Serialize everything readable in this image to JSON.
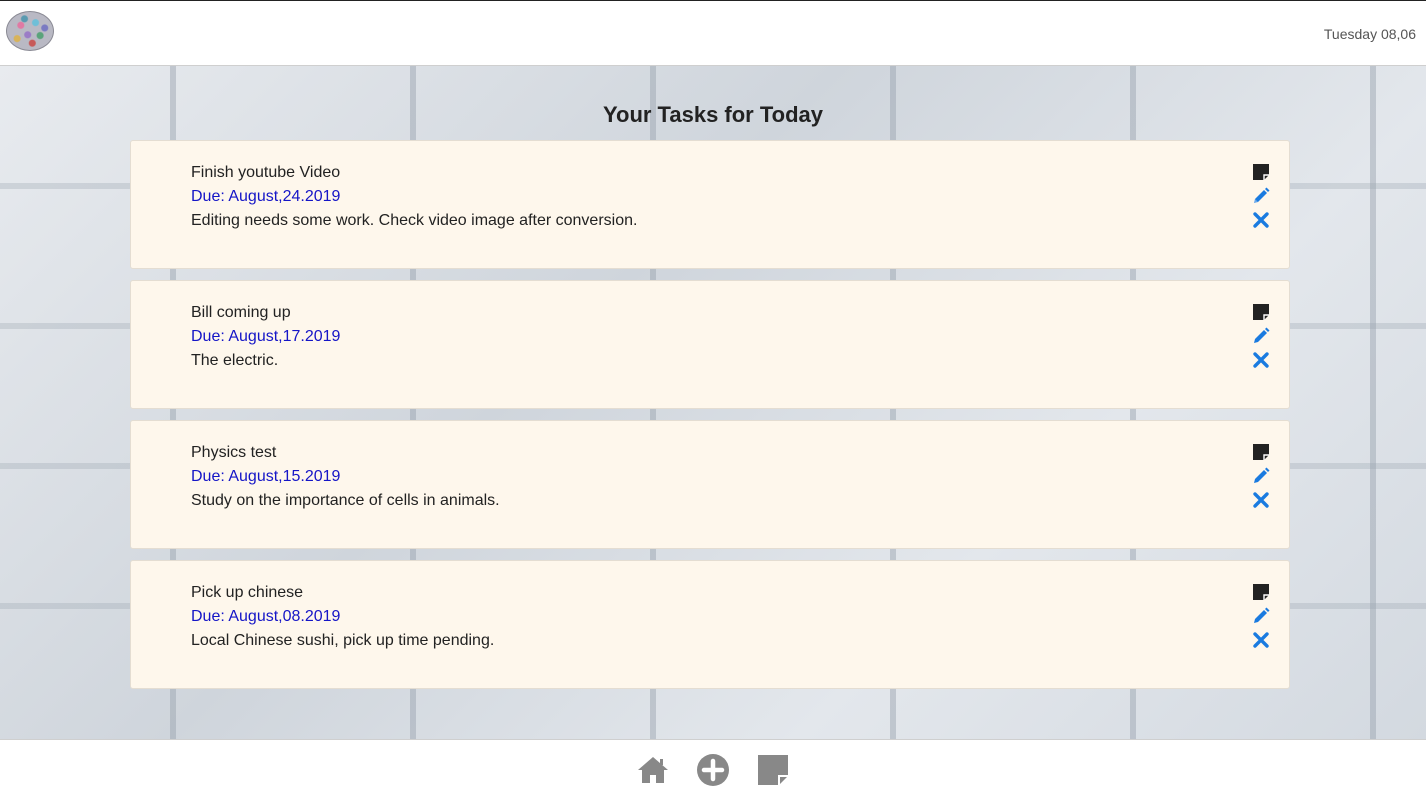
{
  "header": {
    "datetime": "Tuesday 08,06"
  },
  "main": {
    "title": "Your Tasks for Today",
    "tasks": [
      {
        "title": "Finish youtube Video",
        "due": "Due: August,24.2019",
        "description": "Editing needs some work. Check video image after conversion."
      },
      {
        "title": "Bill coming up",
        "due": "Due: August,17.2019",
        "description": "The electric."
      },
      {
        "title": "Physics test",
        "due": "Due: August,15.2019",
        "description": "Study on the importance of cells in animals."
      },
      {
        "title": "Pick up chinese",
        "due": "Due: August,08.2019",
        "description": "Local Chinese sushi, pick up time pending."
      }
    ]
  },
  "icons": {
    "note": "sticky-note-icon",
    "edit": "pencil-icon",
    "delete": "close-icon",
    "home": "home-icon",
    "add": "plus-circle-icon",
    "notes": "sticky-note-icon"
  },
  "colors": {
    "card_bg": "#fef7ec",
    "due_text": "#1515c7",
    "action_blue": "#1a7be0",
    "footer_icon": "#888888"
  }
}
